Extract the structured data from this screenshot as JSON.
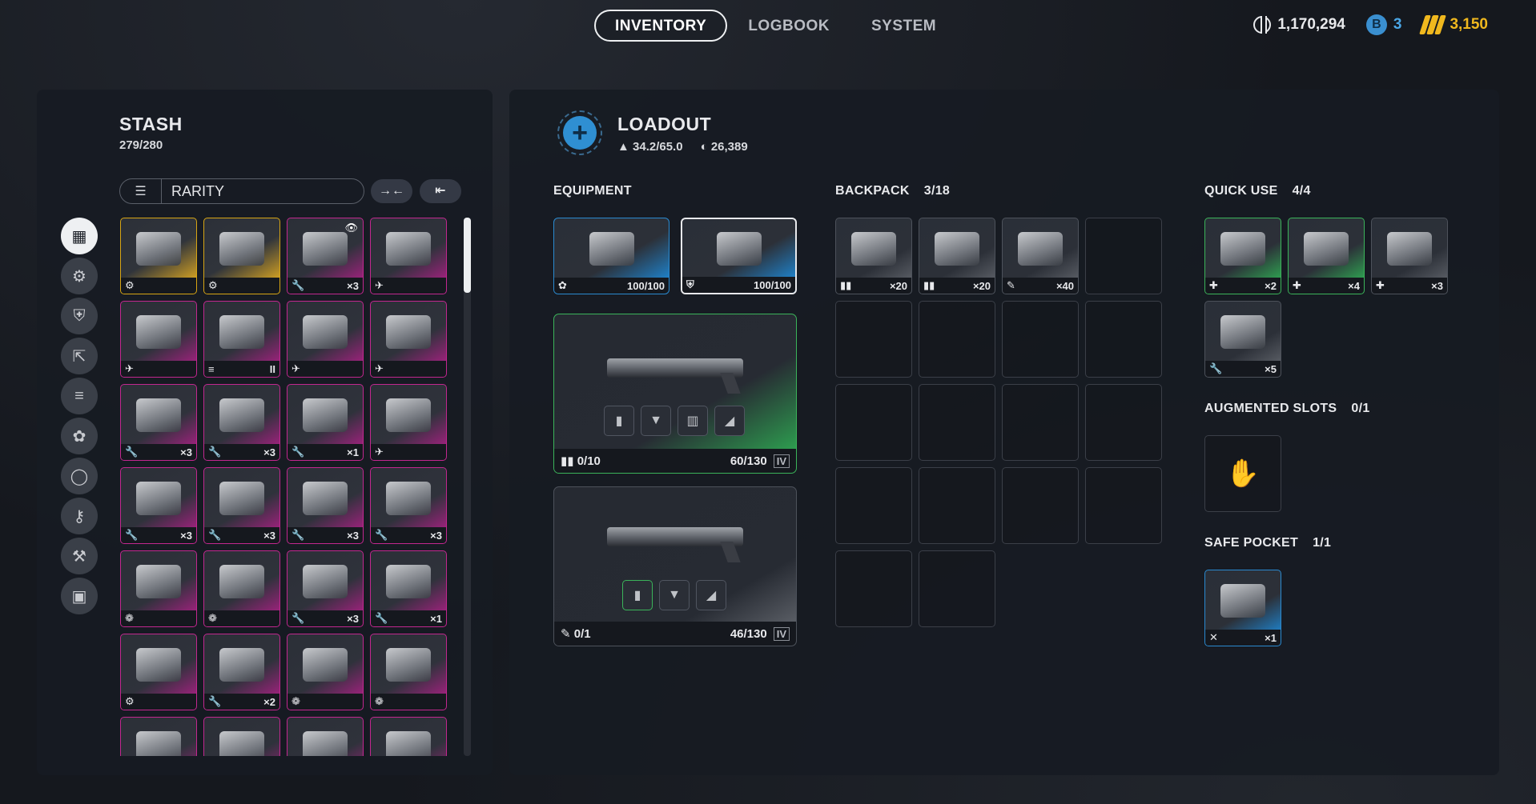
{
  "nav": {
    "tabs": [
      "INVENTORY",
      "LOGBOOK",
      "SYSTEM"
    ]
  },
  "currency": {
    "credits": "1,170,294",
    "blue": "3",
    "gold": "3,150"
  },
  "stash": {
    "title": "STASH",
    "capacity": "279/280",
    "filter": "RARITY",
    "btn1": "→←",
    "btn2": "⇤",
    "items": [
      {
        "r": "leg",
        "icon": "⚙",
        "count": ""
      },
      {
        "r": "leg",
        "icon": "⚙",
        "count": ""
      },
      {
        "r": "epic",
        "icon": "🔧",
        "count": "×3",
        "eye": "👁"
      },
      {
        "r": "epic",
        "icon": "✈",
        "count": ""
      },
      {
        "r": "epic",
        "icon": "✈",
        "count": ""
      },
      {
        "r": "epic",
        "icon": "≡",
        "count": "II"
      },
      {
        "r": "epic",
        "icon": "✈",
        "count": ""
      },
      {
        "r": "epic",
        "icon": "✈",
        "count": ""
      },
      {
        "r": "epic",
        "icon": "🔧",
        "count": "×3"
      },
      {
        "r": "epic",
        "icon": "🔧",
        "count": "×3"
      },
      {
        "r": "epic",
        "icon": "🔧",
        "count": "×1"
      },
      {
        "r": "epic",
        "icon": "✈",
        "count": ""
      },
      {
        "r": "epic",
        "icon": "🔧",
        "count": "×3"
      },
      {
        "r": "epic",
        "icon": "🔧",
        "count": "×3"
      },
      {
        "r": "epic",
        "icon": "🔧",
        "count": "×3"
      },
      {
        "r": "epic",
        "icon": "🔧",
        "count": "×3"
      },
      {
        "r": "epic",
        "icon": "❁",
        "count": ""
      },
      {
        "r": "epic",
        "icon": "❁",
        "count": ""
      },
      {
        "r": "epic",
        "icon": "🔧",
        "count": "×3"
      },
      {
        "r": "epic",
        "icon": "🔧",
        "count": "×1"
      },
      {
        "r": "epic",
        "icon": "⚙",
        "count": ""
      },
      {
        "r": "epic",
        "icon": "🔧",
        "count": "×2"
      },
      {
        "r": "epic",
        "icon": "❁",
        "count": ""
      },
      {
        "r": "epic",
        "icon": "❁",
        "count": ""
      },
      {
        "r": "epic",
        "icon": "",
        "count": ""
      },
      {
        "r": "epic",
        "icon": "",
        "count": ""
      },
      {
        "r": "epic",
        "icon": "",
        "count": ""
      },
      {
        "r": "epic",
        "icon": "",
        "count": ""
      }
    ]
  },
  "loadout": {
    "title": "LOADOUT",
    "weight": "34.2/65.0",
    "value": "26,389",
    "equipment": {
      "label": "EQUIPMENT",
      "slot1": "100/100",
      "slot2": "100/100",
      "weapon1": {
        "ammo": "0/10",
        "durability": "60/130",
        "tier": "IV"
      },
      "weapon2": {
        "ammo": "0/1",
        "durability": "46/130",
        "tier": "IV"
      }
    },
    "backpack": {
      "label": "BACKPACK",
      "count": "3/18",
      "items": [
        "×20",
        "×20",
        "×40"
      ]
    },
    "quick_use": {
      "label": "QUICK USE",
      "count": "4/4",
      "items": [
        "×2",
        "×4",
        "×3",
        "×5"
      ]
    },
    "augmented": {
      "label": "AUGMENTED SLOTS",
      "count": "0/1"
    },
    "safe_pocket": {
      "label": "SAFE POCKET",
      "count": "1/1",
      "item": "×1"
    }
  }
}
